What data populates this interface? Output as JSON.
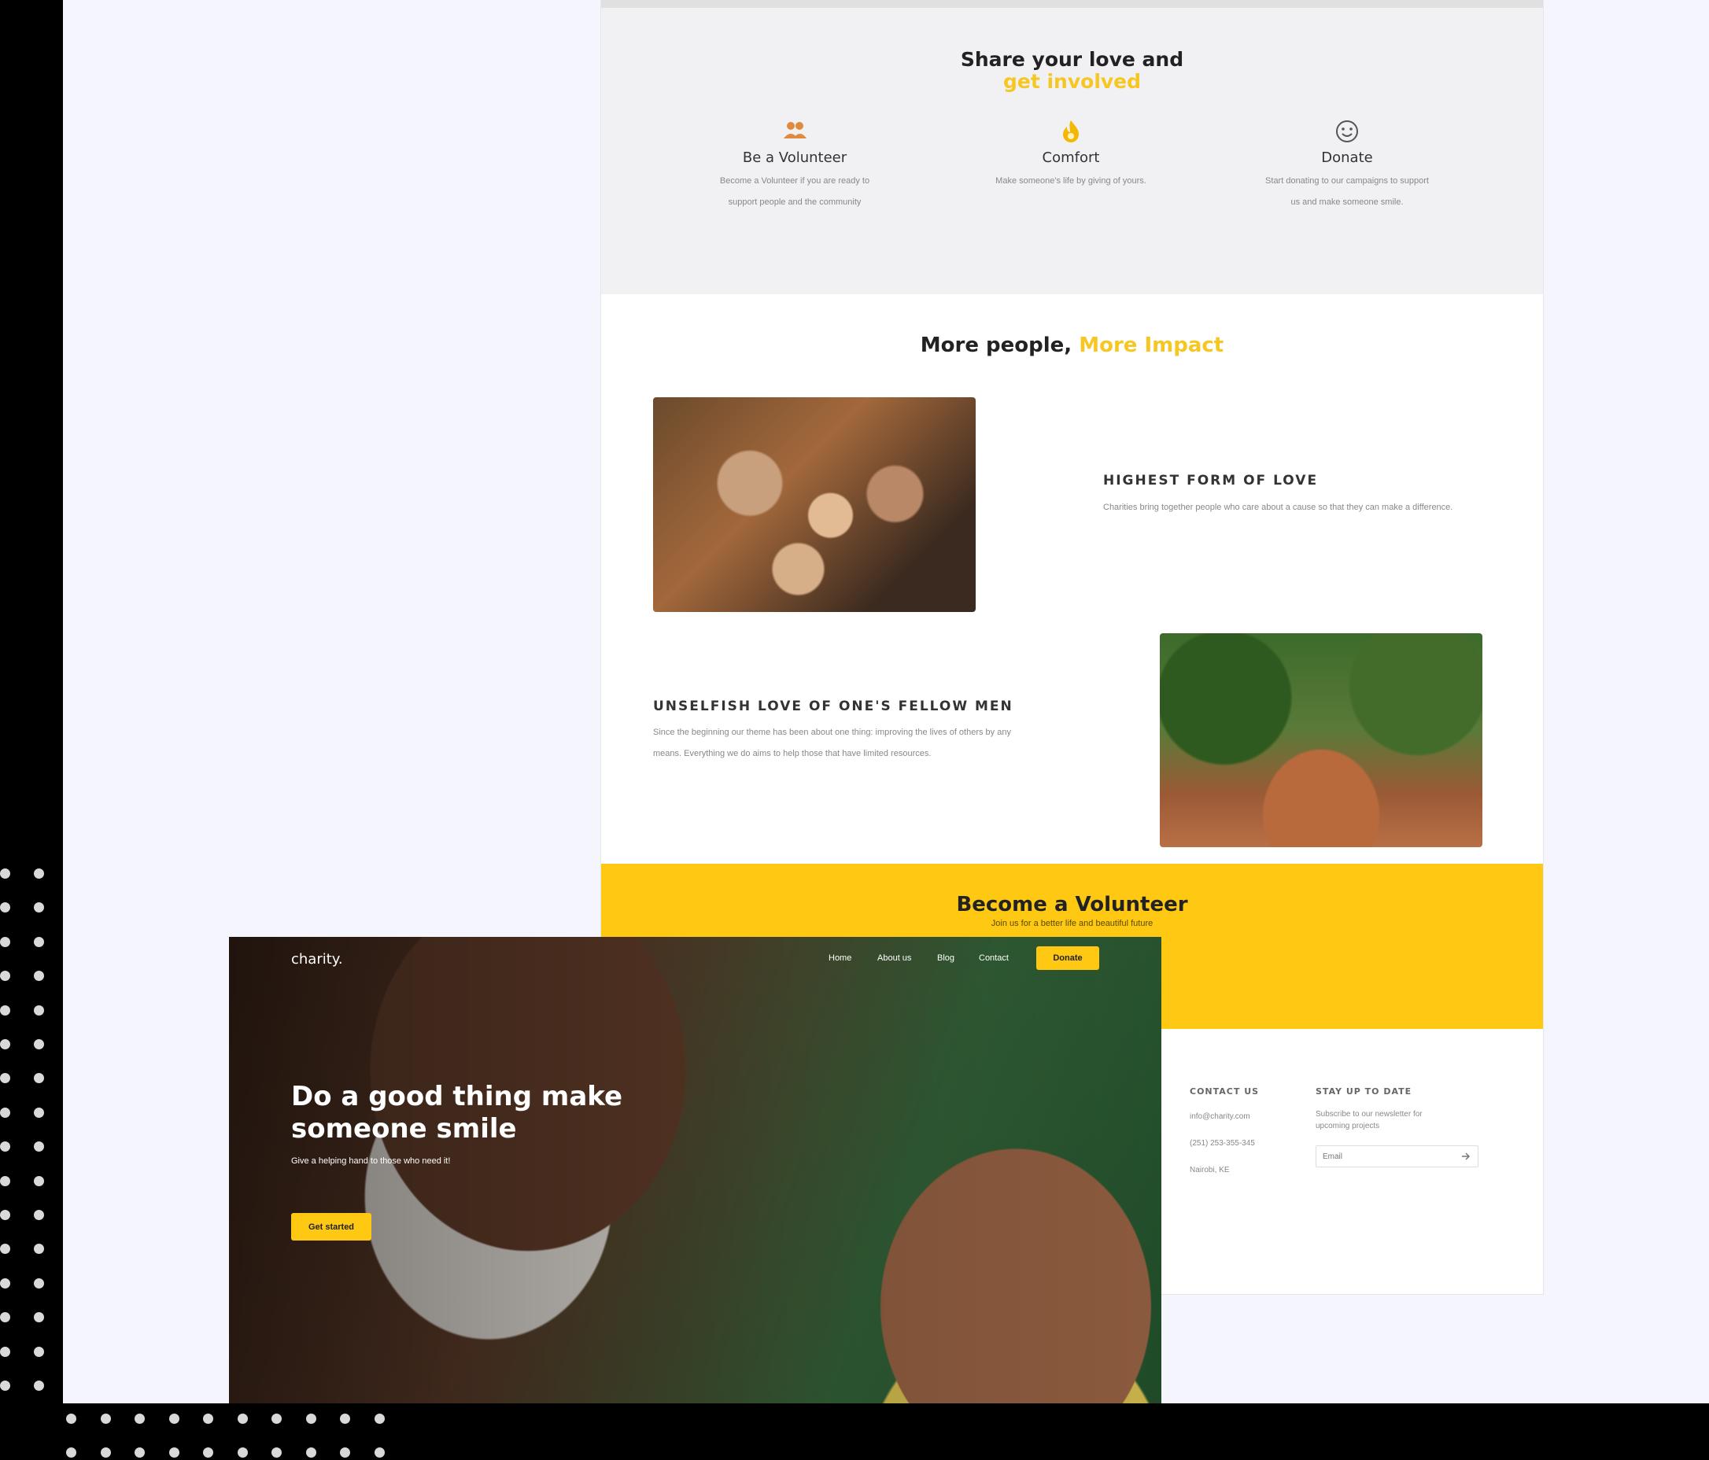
{
  "involved": {
    "title_line1": "Share your love and",
    "title_line2": "get involved",
    "items": [
      {
        "icon": "people-icon",
        "title": "Be a Volunteer",
        "text": "Become a Volunteer if you are ready to support people and the community"
      },
      {
        "icon": "fire-icon",
        "title": "Comfort",
        "text": "Make someone's life by giving of yours."
      },
      {
        "icon": "smile-icon",
        "title": "Donate",
        "text": "Start donating to our campaigns to support us and make someone smile."
      }
    ]
  },
  "impact": {
    "title_plain": "More people,",
    "title_accent": "More Impact",
    "rows": [
      {
        "title": "HIGHEST FORM OF LOVE",
        "text": "Charities bring together people who care about a cause so that they can make a difference."
      },
      {
        "title": "UNSELFISH LOVE OF ONE'S FELLOW MEN",
        "text": "Since the beginning our theme has been about one thing: improving the lives of others by any means. Everything we do aims to help those that have limited resources."
      }
    ]
  },
  "volunteer": {
    "title": "Become a Volunteer",
    "subtitle": "Join us for a better life and beautiful future"
  },
  "footer": {
    "contact_title": "CONTACT US",
    "email": "info@charity.com",
    "phone": "(251) 253-355-345",
    "location": "Nairobi, KE",
    "newsletter_title": "STAY UP TO DATE",
    "newsletter_text": "Subscribe to our newsletter for upcoming projects",
    "email_placeholder": "Email"
  },
  "hero": {
    "logo": "charity.",
    "nav": [
      "Home",
      "About us",
      "Blog",
      "Contact"
    ],
    "donate": "Donate",
    "title": "Do a good thing make someone smile",
    "subtitle": "Give a helping hand to those who need it!",
    "cta": "Get started"
  },
  "colors": {
    "accent": "#fec813",
    "accent_text": "#f6c623",
    "dark": "#222222",
    "page_bg": "#f4f5fd"
  }
}
